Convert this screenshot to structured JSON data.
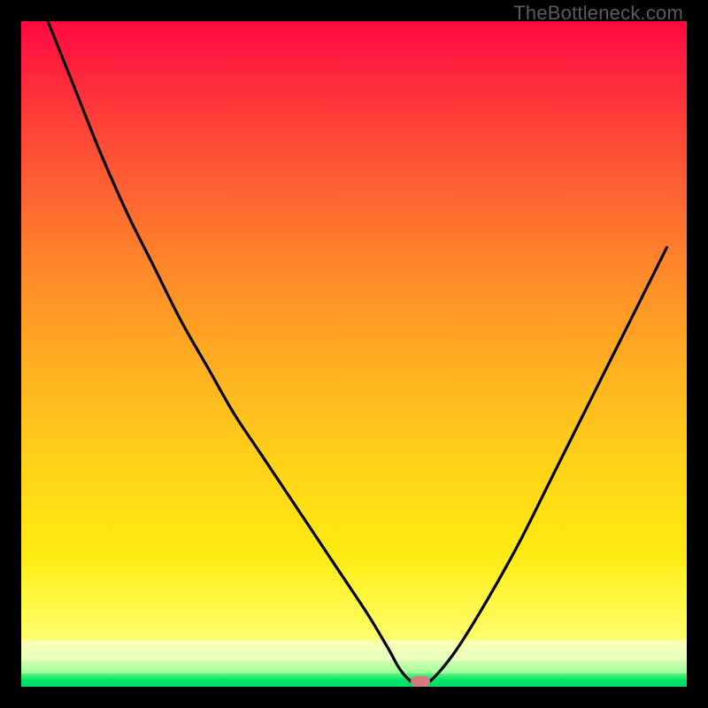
{
  "watermark": "TheBottleneck.com",
  "colors": {
    "black": "#000000",
    "curve": "#000000",
    "marker": "#d67a7f",
    "gradient_top": "#ff0b3f",
    "gradient_mid": "#ffd119",
    "gradient_yellow": "#ffff0c",
    "gradient_green": "#00d866"
  },
  "chart_data": {
    "type": "line",
    "title": "",
    "xlabel": "",
    "ylabel": "",
    "xlim": [
      0,
      100
    ],
    "ylim": [
      0,
      100
    ],
    "series": [
      {
        "name": "bottleneck-curve",
        "x": [
          4,
          8,
          12,
          16,
          20,
          24,
          28,
          32,
          36,
          40,
          44,
          48,
          52,
          55,
          57,
          59,
          61,
          65,
          70,
          75,
          80,
          85,
          90,
          94,
          97
        ],
        "y": [
          100,
          90,
          80,
          71,
          63,
          55,
          48,
          41,
          35,
          29,
          23,
          17,
          11,
          6,
          2.5,
          0.5,
          0.5,
          5,
          13,
          22,
          32,
          42,
          52,
          60,
          66
        ]
      }
    ],
    "marker": {
      "x": 60,
      "width_pct": 3.0,
      "y": 0
    },
    "bands": {
      "hazy_top_pct": 80.0,
      "pale_top_pct": 93.0,
      "yellowgreen_top_pct": 96.0,
      "green_top_pct": 98.0
    }
  }
}
